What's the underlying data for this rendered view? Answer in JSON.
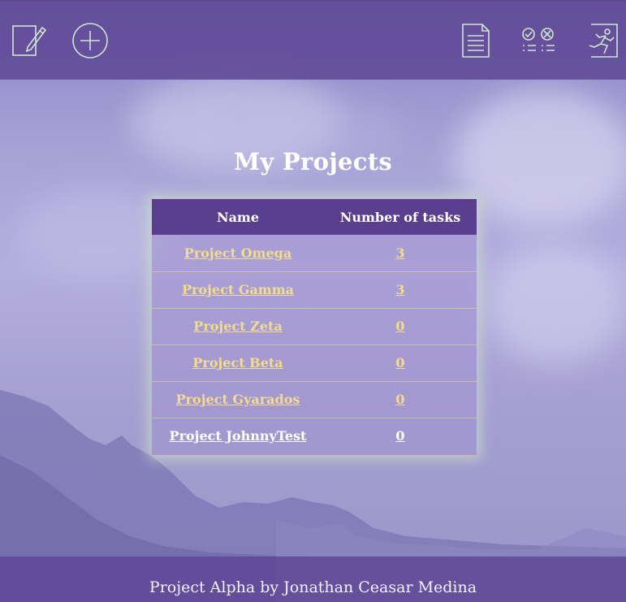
{
  "page": {
    "title": "My Projects"
  },
  "header": {
    "icons": {
      "edit": "edit-icon",
      "add": "add-circle-icon",
      "document": "document-icon",
      "checklist": "checklist-icon",
      "exit": "exit-icon"
    }
  },
  "table": {
    "headers": [
      "Name",
      "Number of tasks"
    ],
    "rows": [
      {
        "name": "Project Omega",
        "tasks": "3"
      },
      {
        "name": "Project Gamma",
        "tasks": "3"
      },
      {
        "name": "Project Zeta",
        "tasks": "0"
      },
      {
        "name": "Project Beta",
        "tasks": "0"
      },
      {
        "name": "Project Gyarados",
        "tasks": "0"
      },
      {
        "name": "Project JohnnyTest",
        "tasks": "0"
      }
    ]
  },
  "footer": {
    "text": "Project Alpha by Jonathan Ceasar Medina"
  },
  "colors": {
    "header_bg": "#604896",
    "table_header_bg": "#5b3f8f",
    "link_gold": "#f3dc8e",
    "link_white": "#ffffff",
    "icon_stroke": "#cfe6cf"
  }
}
